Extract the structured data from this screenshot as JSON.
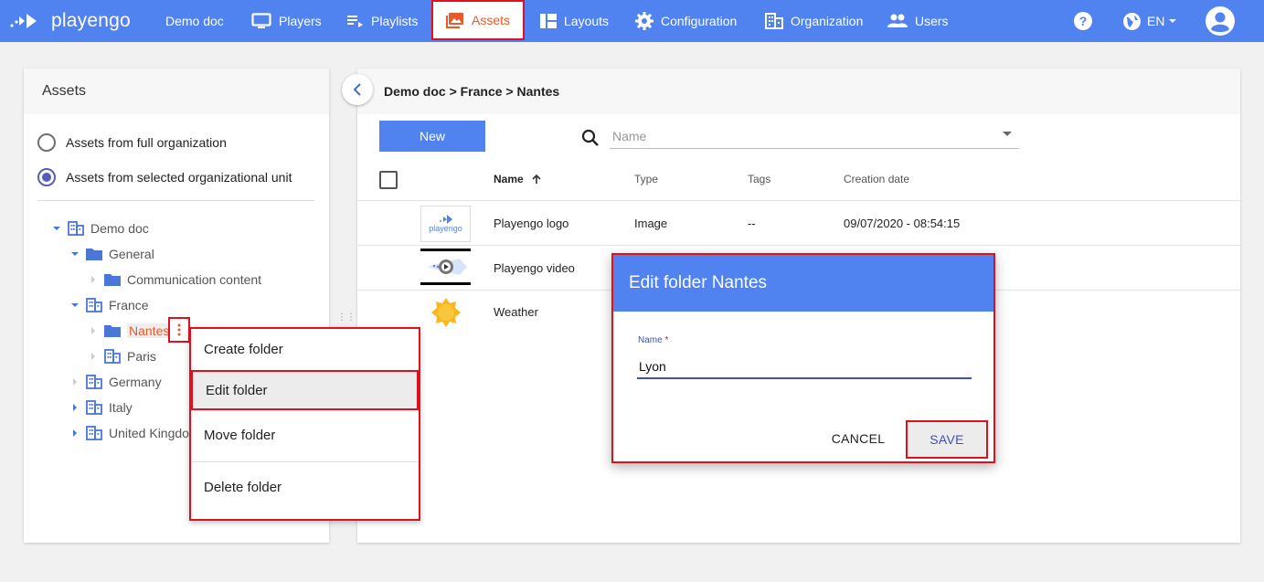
{
  "brand": {
    "name": "playengo"
  },
  "nav": {
    "items": [
      {
        "label": "Demo doc",
        "icon": "none"
      },
      {
        "label": "Players",
        "icon": "monitor-icon"
      },
      {
        "label": "Playlists",
        "icon": "playlist-icon"
      },
      {
        "label": "Assets",
        "icon": "image-icon",
        "active": true
      },
      {
        "label": "Layouts",
        "icon": "layout-icon"
      },
      {
        "label": "Configuration",
        "icon": "gear-icon"
      },
      {
        "label": "Organization",
        "icon": "building-icon"
      },
      {
        "label": "Users",
        "icon": "users-icon"
      }
    ],
    "language": "EN"
  },
  "left_panel": {
    "title": "Assets",
    "radio_full": "Assets from full organization",
    "radio_selected": "Assets from selected organizational unit",
    "tree": {
      "demo_doc": "Demo doc",
      "general": "General",
      "communication": "Communication content",
      "france": "France",
      "nantes": "Nantes",
      "paris": "Paris",
      "germany": "Germany",
      "italy": "Italy",
      "uk": "United Kingdo"
    }
  },
  "context_menu": {
    "create": "Create folder",
    "edit": "Edit folder",
    "move": "Move folder",
    "delete": "Delete folder"
  },
  "right_panel": {
    "breadcrumb": "Demo doc > France > Nantes",
    "new_button": "New",
    "search_placeholder": "Name",
    "columns": {
      "name": "Name",
      "type": "Type",
      "tags": "Tags",
      "created": "Creation date"
    },
    "rows": [
      {
        "name": "Playengo logo",
        "type": "Image",
        "tags": "--",
        "created": "09/07/2020 - 08:54:15",
        "thumb_text": "playengo"
      },
      {
        "name": "Playengo video",
        "type": "",
        "tags": "",
        "created": ""
      },
      {
        "name": "Weather",
        "type": "",
        "tags": "",
        "created": ""
      }
    ]
  },
  "dialog": {
    "title": "Edit folder Nantes",
    "field_label": "Name",
    "required_mark": "*",
    "field_value": "Lyon",
    "cancel": "CANCEL",
    "save": "SAVE"
  },
  "colors": {
    "primary": "#5083ef",
    "accent": "#e8592b",
    "highlight_border": "#e0101e",
    "indigo": "#3f51b5"
  }
}
